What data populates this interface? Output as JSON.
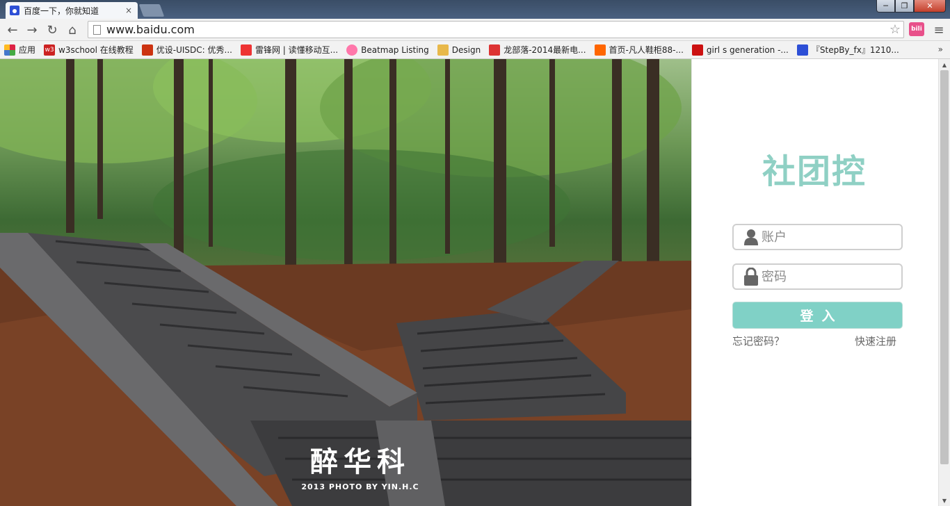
{
  "browser": {
    "tab": {
      "title": "百度一下，你就知道",
      "close": "×"
    },
    "window_buttons": {
      "minimize": "─",
      "restore": "❐",
      "close": "✕"
    },
    "nav": {
      "back": "←",
      "forward": "→",
      "reload": "↻",
      "home": "⌂"
    },
    "address": {
      "url": "www.baidu.com",
      "star": "☆"
    },
    "extension_label": "bili",
    "menu_glyph": "≡",
    "bookmarks": [
      {
        "label": "应用",
        "icon": "apps-icon",
        "color": "#d24"
      },
      {
        "label": "w3school 在线教程",
        "icon": "w3-icon",
        "color": "#c22"
      },
      {
        "label": "优设-UISDC: 优秀...",
        "icon": "uisdc-icon",
        "color": "#c31"
      },
      {
        "label": "雷锋网 | 读懂移动互...",
        "icon": "leifeng-icon",
        "color": "#e33"
      },
      {
        "label": "Beatmap Listing",
        "icon": "osu-icon",
        "color": "#f7a"
      },
      {
        "label": "Design",
        "icon": "folder-icon",
        "color": "#e8b84a"
      },
      {
        "label": "龙部落-2014最新电...",
        "icon": "longbuluo-icon",
        "color": "#d33"
      },
      {
        "label": "首页-凡人鞋柜88-...",
        "icon": "taobao-icon",
        "color": "#f60"
      },
      {
        "label": "girl s generation -...",
        "icon": "bow-icon",
        "color": "#c11"
      },
      {
        "label": "『StepBy_fx』1210...",
        "icon": "baidu-paw-icon",
        "color": "#2d4fd6"
      }
    ],
    "bookmarks_more": "»"
  },
  "photo": {
    "watermark_title": "醉华科",
    "watermark_caption": "2013 PHOTO BY YIN.H.C"
  },
  "login": {
    "logo": "社团控",
    "account_placeholder": "账户",
    "password_placeholder": "密码",
    "submit_label": "登入",
    "forgot_label": "忘记密码？",
    "register_label": "快速注册",
    "accent_color": "#80d1c6"
  },
  "scrollbar": {
    "up": "▲",
    "down": "▼"
  }
}
